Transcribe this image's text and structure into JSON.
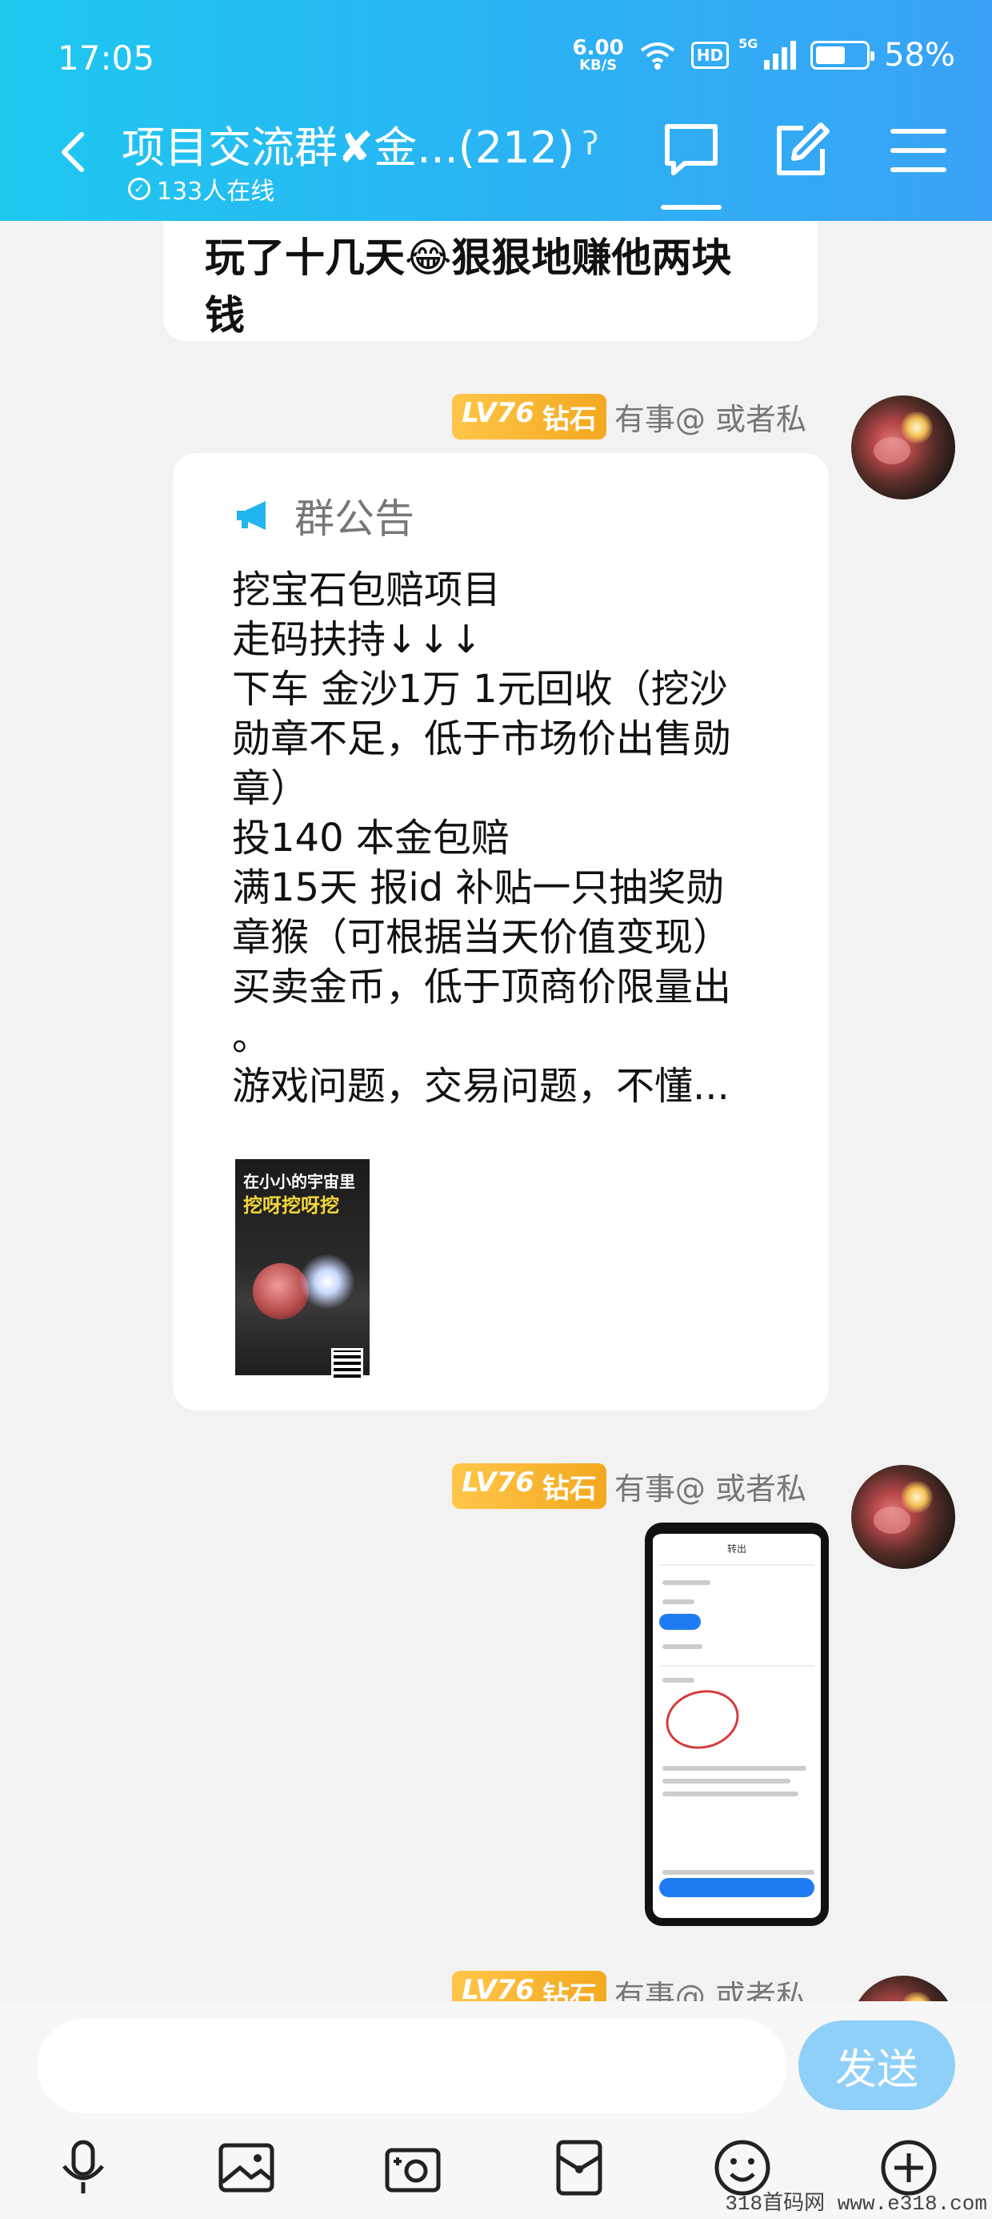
{
  "status_bar": {
    "time": "17:05",
    "net_speed": "6.00",
    "net_unit": "KB/S",
    "hd": "HD",
    "network": "5G",
    "battery": "58%",
    "battery_level": 0.58
  },
  "header": {
    "title": "项目交流群✘金...(212)",
    "online": "133人在线"
  },
  "messages": {
    "previous": {
      "lines": [
        "玩了十几天😂狠狠地赚他两块",
        "钱"
      ]
    },
    "sender": {
      "level": "LV76",
      "rank": "钻石",
      "name": "有事@  或者私"
    },
    "notice": {
      "heading": "群公告",
      "lines": [
        "挖宝石包赔项目",
        "走码扶持↓↓↓",
        "下车 金沙1万 1元回收（挖沙",
        "勋章不足，低于市场价出售勋",
        "章）",
        "投140 本金包赔",
        "满15天 报id 补贴一只抽奖勋",
        "章猴（可根据当天价值变现）",
        "买卖金币，低于顶商价限量出",
        "。",
        "游戏问题，交易问题，不懂..."
      ],
      "poster_text_1": "在小小的宇宙里",
      "poster_text_2": "挖呀挖呀挖"
    },
    "screenshot": {
      "title": "转出"
    }
  },
  "input_bar": {
    "placeholder": "",
    "send": "发送"
  },
  "watermark": "318首码网  www.e318.com",
  "colors": {
    "header_start": "#1ec8ef",
    "header_end": "#3aa2f6",
    "send_button": "#8fd0f9",
    "level_badge": "#f3a81f"
  }
}
